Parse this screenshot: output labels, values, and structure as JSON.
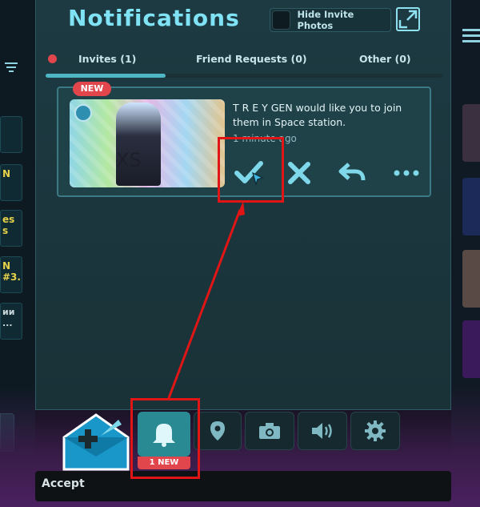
{
  "panel": {
    "title": "Notifications",
    "hide_photos_label": "Hide Invite Photos"
  },
  "tabs": [
    {
      "label": "Invites (1)",
      "active": true
    },
    {
      "label": "Friend Requests (0)",
      "active": false
    },
    {
      "label": "Other (0)",
      "active": false
    }
  ],
  "notification": {
    "badge": "NEW",
    "message": "T R E Y GEN would like you to join them in Space station.",
    "time": "1 minute ago",
    "thumbnail_text": "XS",
    "actions": [
      {
        "name": "accept",
        "icon": "check-icon"
      },
      {
        "name": "decline",
        "icon": "x-icon"
      },
      {
        "name": "reply",
        "icon": "reply-icon"
      },
      {
        "name": "more",
        "icon": "more-icon"
      }
    ]
  },
  "left_sidebar": {
    "items": [
      {
        "text": "N"
      },
      {
        "text": "es\ns"
      },
      {
        "text": "N\n#3..."
      },
      {
        "text": "ии ..."
      }
    ]
  },
  "dock": {
    "items": [
      "bell-icon",
      "location-icon",
      "camera-icon",
      "volume-icon",
      "settings-icon"
    ],
    "new_count_label": "1 NEW"
  },
  "status_bar": {
    "text": "Accept"
  },
  "colors": {
    "accent": "#7fe3f5",
    "alert": "#e2464d",
    "highlight": "#e01616",
    "panel_bg": "#1d3a42"
  }
}
